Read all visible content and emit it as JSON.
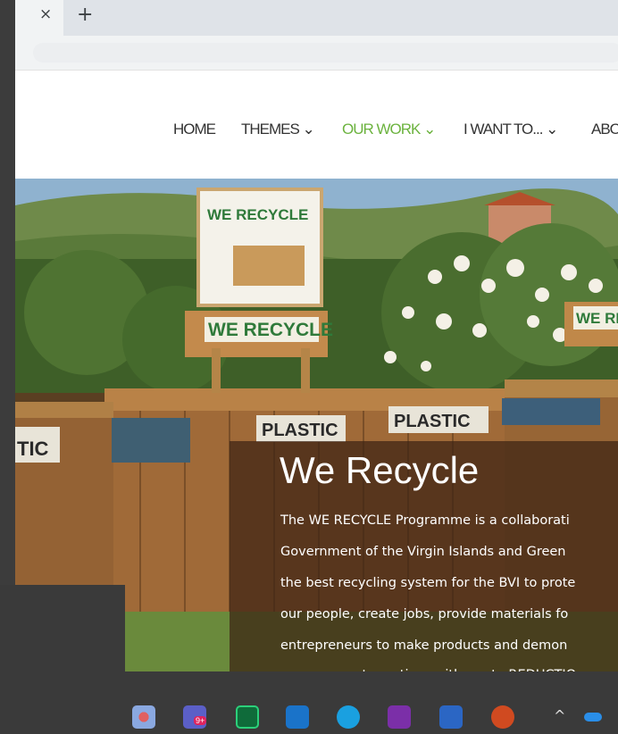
{
  "browser": {
    "tab_close": "×",
    "new_tab": "+"
  },
  "nav": {
    "items": [
      "HOME",
      "THEMES ⌄",
      "OUR WORK ⌄",
      "I WANT TO... ⌄",
      "ABO"
    ],
    "active_color": "#6cb33f"
  },
  "hero": {
    "title": "We Recycle",
    "lines": [
      "The WE RECYCLE Programme is a collaborati",
      "Government of the Virgin Islands and Green",
      "the best recycling system for the BVI to prote",
      "our people, create jobs, provide materials fo",
      "entrepreneurs to make products and demon",
      "management practices with waste REDUCTIO"
    ]
  },
  "photo_signs": {
    "we_recycle_top": "WE RECYCLE",
    "we_recycle_board": "WE RECYCLE",
    "we_re": "WE RE",
    "plastic_1": "PLASTIC",
    "plastic_2": "PLASTIC",
    "tic": "TIC"
  },
  "taskbar": {
    "icons": [
      "settings-app-icon",
      "teams-icon",
      "sharepoint-icon",
      "outlook-icon",
      "skype-icon",
      "onenote-icon",
      "word-icon",
      "powerpoint-icon",
      "chevron-up-icon",
      "onedrive-icon"
    ],
    "teams_badge": "9+"
  }
}
